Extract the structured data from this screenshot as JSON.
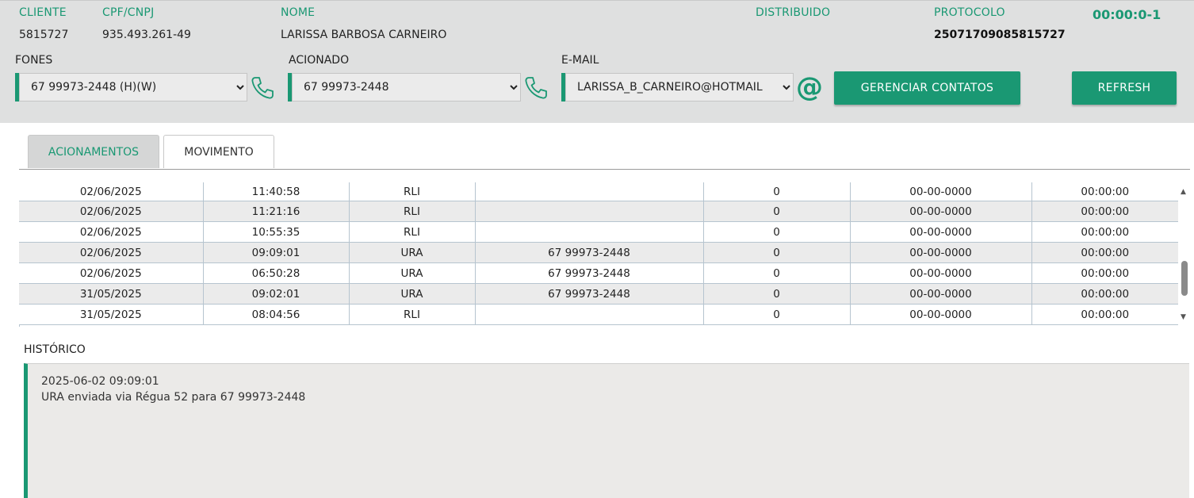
{
  "header": {
    "cliente_label": "CLIENTE",
    "cliente_value": "5815727",
    "cpf_label": "CPF/CNPJ",
    "cpf_value": "935.493.261-49",
    "nome_label": "NOME",
    "nome_value": "LARISSA BARBOSA CARNEIRO",
    "distribuido_label": "DISTRIBUIDO",
    "protocolo_label": "PROTOCOLO",
    "protocolo_value": "25071709085815727",
    "timer": "00:00:0-1"
  },
  "contacts": {
    "fones_label": "FONES",
    "fones_selected": "67 99973-2448 (H)(W)",
    "acionado_label": "ACIONADO",
    "acionado_selected": "67 99973-2448",
    "email_label": "E-MAIL",
    "email_selected": "LARISSA_B_CARNEIRO@HOTMAIL",
    "at_symbol": "@",
    "gerenciar_label": "GERENCIAR CONTATOS",
    "refresh_label": "REFRESH"
  },
  "tabs": [
    {
      "label": "ACIONAMENTOS",
      "active": true
    },
    {
      "label": "MOVIMENTO",
      "active": false
    }
  ],
  "rows": [
    [
      "02/06/2025",
      "11:40:58",
      "RLI",
      "",
      "0",
      "00-00-0000",
      "00:00:00"
    ],
    [
      "02/06/2025",
      "11:21:16",
      "RLI",
      "",
      "0",
      "00-00-0000",
      "00:00:00"
    ],
    [
      "02/06/2025",
      "10:55:35",
      "RLI",
      "",
      "0",
      "00-00-0000",
      "00:00:00"
    ],
    [
      "02/06/2025",
      "09:09:01",
      "URA",
      "67 99973-2448",
      "0",
      "00-00-0000",
      "00:00:00"
    ],
    [
      "02/06/2025",
      "06:50:28",
      "URA",
      "67 99973-2448",
      "0",
      "00-00-0000",
      "00:00:00"
    ],
    [
      "31/05/2025",
      "09:02:01",
      "URA",
      "67 99973-2448",
      "0",
      "00-00-0000",
      "00:00:00"
    ],
    [
      "31/05/2025",
      "08:04:56",
      "RLI",
      "",
      "0",
      "00-00-0000",
      "00:00:00"
    ]
  ],
  "historico": {
    "label": "HISTÓRICO",
    "line1": "2025-06-02 09:09:01",
    "line2": "URA enviada via Régua 52 para 67 99973-2448"
  },
  "colors": {
    "accent": "#1a9873",
    "header_bg": "#dfe0e0",
    "row_alt": "#ebebeb"
  },
  "icons": [
    "phone-icon",
    "phone-icon",
    "email-at-icon",
    "scroll-up-icon",
    "scroll-down-icon"
  ]
}
